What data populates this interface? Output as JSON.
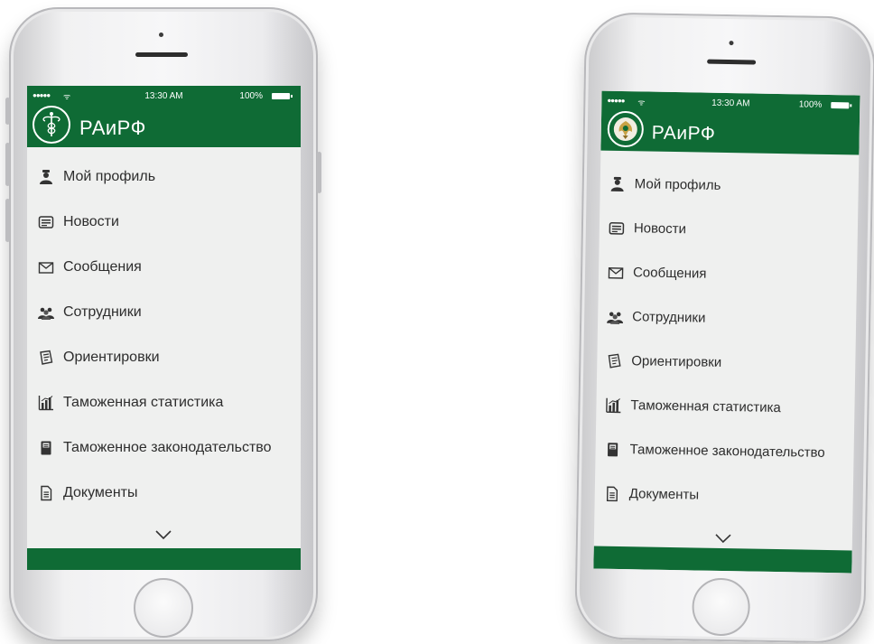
{
  "phones": [
    {
      "status": {
        "signal": "●●●●●",
        "wifi": "ᯤ",
        "time": "13:30 AM",
        "battery": "100%"
      },
      "app_title": "РАиРФ",
      "menu": [
        {
          "label": "Мой профиль",
          "icon": "user-officer-icon"
        },
        {
          "label": "Новости",
          "icon": "news-icon"
        },
        {
          "label": "Сообщения",
          "icon": "envelope-icon"
        },
        {
          "label": "Сотрудники",
          "icon": "employees-icon"
        },
        {
          "label": "Ориентировки",
          "icon": "orientation-doc-icon"
        },
        {
          "label": "Таможенная статистика",
          "icon": "bar-chart-icon"
        },
        {
          "label": "Таможенное законодательство",
          "icon": "law-book-icon"
        },
        {
          "label": "Документы",
          "icon": "document-icon"
        }
      ]
    },
    {
      "status": {
        "signal": "●●●●●",
        "wifi": "ᯤ",
        "time": "13:30 AM",
        "battery": "100%"
      },
      "app_title": "РАиРФ",
      "menu": [
        {
          "label": "Мой профиль",
          "icon": "user-officer-icon"
        },
        {
          "label": "Новости",
          "icon": "news-icon"
        },
        {
          "label": "Сообщения",
          "icon": "envelope-icon"
        },
        {
          "label": "Сотрудники",
          "icon": "employees-icon"
        },
        {
          "label": "Ориентировки",
          "icon": "orientation-doc-icon"
        },
        {
          "label": "Таможенная статистика",
          "icon": "bar-chart-icon"
        },
        {
          "label": "Таможенное законодательство",
          "icon": "law-book-icon"
        },
        {
          "label": "Документы",
          "icon": "document-icon"
        }
      ]
    }
  ],
  "colors": {
    "brand_green": "#0f6b35",
    "screen_bg": "#eff0ef",
    "text": "#2d2d2d"
  }
}
